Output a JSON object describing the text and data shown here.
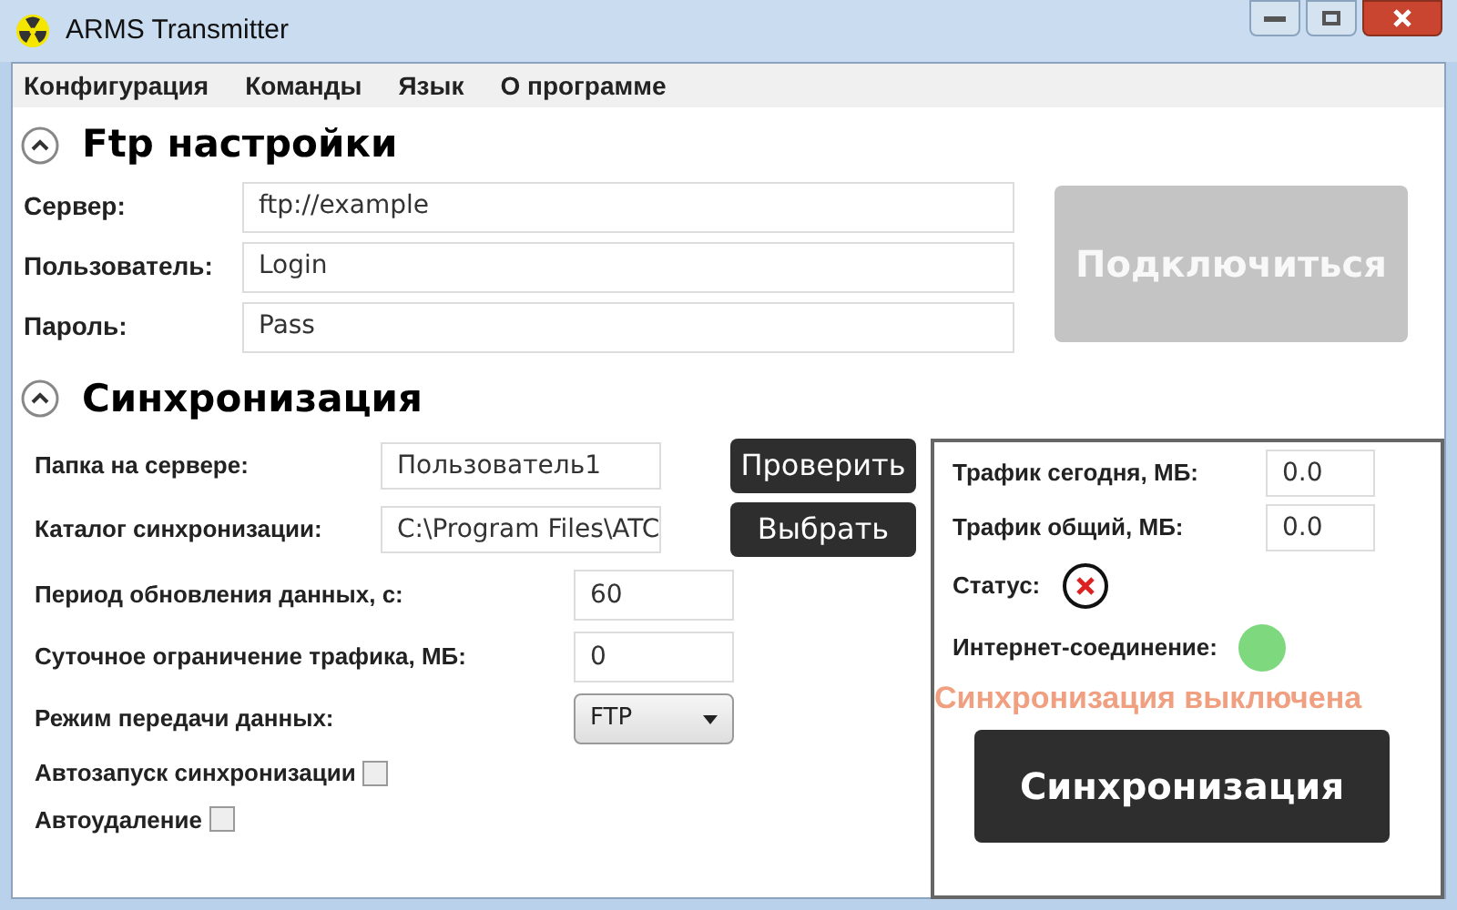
{
  "window": {
    "title": "ARMS Transmitter"
  },
  "menu": [
    "Конфигурация",
    "Команды",
    "Язык",
    "О программе"
  ],
  "ftp_section": {
    "title": "Ftp настройки",
    "expanded": true,
    "fields": [
      {
        "label": "Сервер:",
        "value": "ftp://example"
      },
      {
        "label": "Пользователь:",
        "value": "Login"
      },
      {
        "label": "Пароль:",
        "value": "Pass"
      }
    ],
    "connect_button": {
      "label": "Подключиться",
      "disabled": true
    }
  },
  "sync_section": {
    "title": "Синхронизация",
    "expanded": true,
    "folder_fields": [
      {
        "label": "Папка на сервере:",
        "value": "Пользователь1",
        "button": "Проверить"
      },
      {
        "label": "Каталог синхронизации:",
        "value": "C:\\Program Files\\ATC",
        "button": "Выбрать"
      }
    ],
    "settings": [
      {
        "kind": "input",
        "label": "Период обновления данных, с:",
        "value": "60"
      },
      {
        "kind": "input",
        "label": "Суточное ограничение трафика, МБ:",
        "value": "0"
      },
      {
        "kind": "select",
        "label": "Режим передачи данных:",
        "value": "FTP"
      }
    ],
    "checkboxes": [
      {
        "label": "Автозапуск синхронизации",
        "checked": false
      },
      {
        "label": "Автоудаление",
        "checked": false
      }
    ],
    "stats": [
      {
        "label": "Трафик сегодня, МБ:",
        "value": "0.0"
      },
      {
        "label": "Трафик общий, МБ:",
        "value": "0.0"
      }
    ],
    "status": {
      "label": "Статус:",
      "ok": false
    },
    "internet": {
      "label": "Интернет-соединение:",
      "color": "#7ed87e"
    },
    "sync_message": "Синхронизация выключена",
    "sync_button": "Синхронизация"
  }
}
